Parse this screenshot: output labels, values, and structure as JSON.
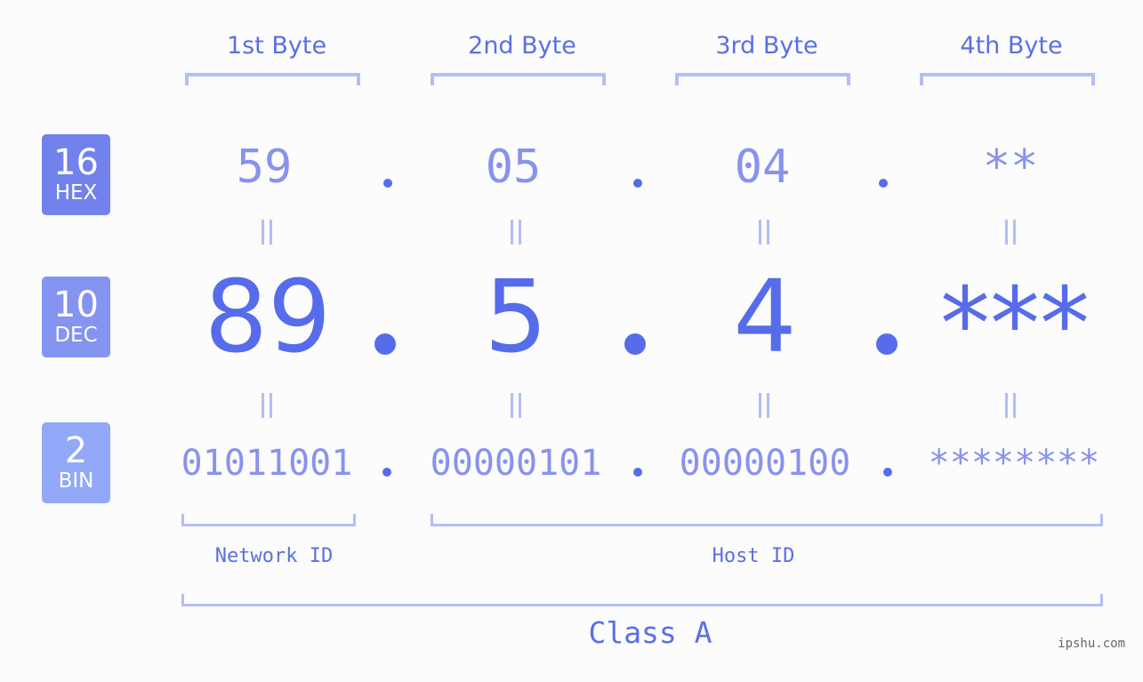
{
  "headers": [
    "1st Byte",
    "2nd Byte",
    "3rd Byte",
    "4th Byte"
  ],
  "badges": {
    "hex": {
      "number": "16",
      "label": "HEX",
      "color": "#7281ec"
    },
    "dec": {
      "number": "10",
      "label": "DEC",
      "color": "#8593f1"
    },
    "bin": {
      "number": "2",
      "label": "BIN",
      "color": "#92a8f8"
    }
  },
  "hex_values": [
    "59",
    "05",
    "04",
    "**"
  ],
  "dec_values": [
    "89",
    "5",
    "4",
    "***"
  ],
  "bin_values": [
    "01011001",
    "00000101",
    "00000100",
    "********"
  ],
  "labels": {
    "network_id": "Network ID",
    "host_id": "Host ID",
    "class": "Class A"
  },
  "watermark": "ipshu.com",
  "colors": {
    "accent": "#566ceb",
    "light_value": "#8892ee",
    "bracket": "#b3bdf8",
    "background": "#fbfcfb"
  }
}
